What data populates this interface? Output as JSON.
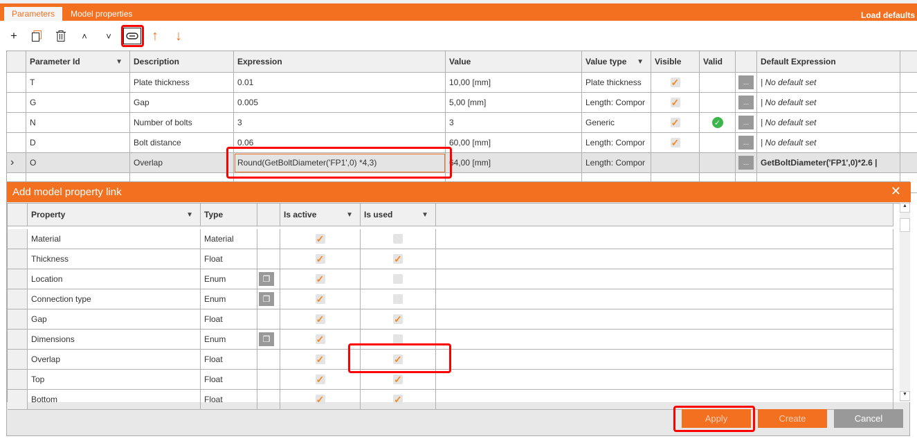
{
  "tabs": [
    {
      "label": "Parameters",
      "active": true
    },
    {
      "label": "Model properties",
      "active": false
    }
  ],
  "load_defaults": "Load defaults",
  "toolbar": {
    "add": "+",
    "copy": "copy-icon",
    "delete": "trash-icon",
    "up": "˄",
    "down": "˅",
    "link": "link-icon",
    "move_up": "↑",
    "move_down": "↓"
  },
  "params": {
    "headers": [
      "Parameter Id",
      "Description",
      "Expression",
      "Value",
      "Value type",
      "Visible",
      "Valid",
      "",
      "Default Expression"
    ],
    "rows": [
      {
        "id": "T",
        "desc": "Plate thickness",
        "expr": "0.01",
        "value": "10,00 [mm]",
        "type": "Plate thickness",
        "visible": true,
        "valid": false,
        "def": "|  No default set",
        "def_bold": false
      },
      {
        "id": "G",
        "desc": "Gap",
        "expr": "0.005",
        "value": "5,00 [mm]",
        "type": "Length: Compor",
        "visible": true,
        "valid": false,
        "def": "|  No default set",
        "def_bold": false
      },
      {
        "id": "N",
        "desc": "Number of bolts",
        "expr": "3",
        "value": "3",
        "type": "Generic",
        "visible": true,
        "valid": true,
        "def": "|  No default set",
        "def_bold": false
      },
      {
        "id": "D",
        "desc": "Bolt distance",
        "expr": "0.06",
        "value": "60,00 [mm]",
        "type": "Length: Compor",
        "visible": true,
        "valid": false,
        "def": "|  No default set",
        "def_bold": false
      },
      {
        "id": "O",
        "desc": "Overlap",
        "expr": "Round(GetBoltDiameter('FP1',0) *4,3)",
        "value": "64,00 [mm]",
        "type": "Length: Compor",
        "visible": false,
        "valid": false,
        "def": "GetBoltDiameter('FP1',0)*2.6 |",
        "def_bold": true,
        "selected": true
      }
    ],
    "dots": "..."
  },
  "dialog": {
    "title": "Add model property link",
    "headers": [
      "Property",
      "Type",
      "",
      "Is active",
      "Is used"
    ],
    "rows": [
      {
        "prop": "Material",
        "type": "Material",
        "copy": false,
        "active": true,
        "used": false
      },
      {
        "prop": "Thickness",
        "type": "Float",
        "copy": false,
        "active": true,
        "used": true
      },
      {
        "prop": "Location",
        "type": "Enum",
        "copy": true,
        "active": true,
        "used": false
      },
      {
        "prop": "Connection type",
        "type": "Enum",
        "copy": true,
        "active": true,
        "used": false
      },
      {
        "prop": "Gap",
        "type": "Float",
        "copy": false,
        "active": true,
        "used": true
      },
      {
        "prop": "Dimensions",
        "type": "Enum",
        "copy": true,
        "active": true,
        "used": false
      },
      {
        "prop": "Overlap",
        "type": "Float",
        "copy": false,
        "active": true,
        "used": true
      },
      {
        "prop": "Top",
        "type": "Float",
        "copy": false,
        "active": true,
        "used": true
      },
      {
        "prop": "Bottom",
        "type": "Float",
        "copy": false,
        "active": true,
        "used": true
      }
    ],
    "apply": "Apply",
    "create": "Create",
    "cancel": "Cancel"
  },
  "colors": {
    "accent": "#f37021",
    "highlight": "#ff0000"
  }
}
